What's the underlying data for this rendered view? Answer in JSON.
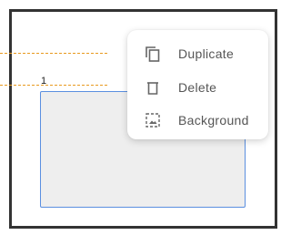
{
  "canvas": {
    "element_number": "1"
  },
  "context_menu": {
    "items": [
      {
        "label": "Duplicate",
        "icon": "duplicate-icon"
      },
      {
        "label": "Delete",
        "icon": "trash-icon"
      },
      {
        "label": "Background",
        "icon": "background-image-icon"
      }
    ]
  },
  "colors": {
    "frame_border": "#333333",
    "guide_line": "#e89a1f",
    "selection_border": "#5b8fe0",
    "shape_fill": "#eeeeee",
    "menu_text": "#555555"
  }
}
